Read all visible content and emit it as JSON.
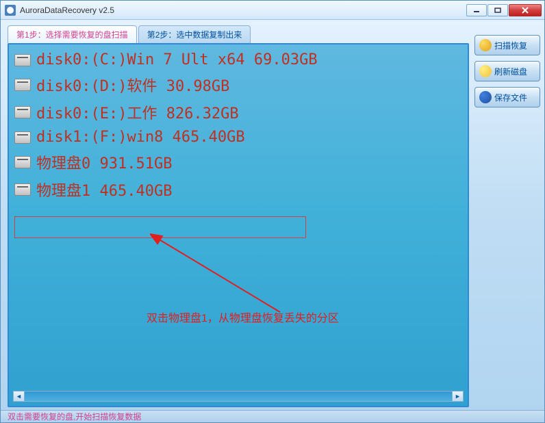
{
  "window": {
    "title": "AuroraDataRecovery v2.5"
  },
  "tabs": [
    {
      "label": "第1步：选择需要恢复的盘扫描",
      "active": true
    },
    {
      "label": "第2步：选中数据复制出来",
      "active": false
    }
  ],
  "disks": [
    {
      "label": "disk0:(C:)Win 7 Ult x64 69.03GB"
    },
    {
      "label": "disk0:(D:)软件 30.98GB"
    },
    {
      "label": "disk0:(E:)工作 826.32GB"
    },
    {
      "label": "disk1:(F:)win8 465.40GB"
    },
    {
      "label": "物理盘0 931.51GB"
    },
    {
      "label": "物理盘1 465.40GB"
    }
  ],
  "annotation": {
    "text": "双击物理盘1，从物理盘恢复丢失的分区"
  },
  "side_buttons": {
    "scan_recover": "扫描恢复",
    "refresh_disk": "刷新磁盘",
    "save_file": "保存文件"
  },
  "statusbar": "双击需要恢复的盘,开始扫描恢复数据"
}
